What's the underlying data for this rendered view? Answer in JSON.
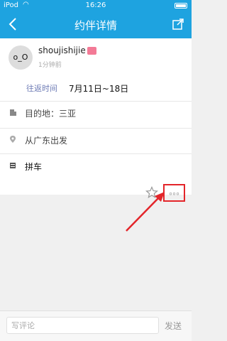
{
  "status_bar": {
    "carrier": "iPod",
    "time": "16:26"
  },
  "nav": {
    "title": "约伴详情",
    "back_icon": "chevron-left-icon",
    "edit_icon": "share-edit-icon"
  },
  "post": {
    "avatar_text": "o_O",
    "username": "shoujishijie",
    "time_ago": "1分钟前",
    "period_label": "往返时间",
    "period_value": "7月11日~18日",
    "destination": "目的地：三亚",
    "departure": "从广东出发",
    "mode": "拼车"
  },
  "actions": {
    "more_label": "◦◦◦",
    "star_icon": "star-outline-icon"
  },
  "annotation": {
    "color": "#e3252a"
  },
  "comment": {
    "placeholder": "写评论",
    "send_label": "发送"
  }
}
